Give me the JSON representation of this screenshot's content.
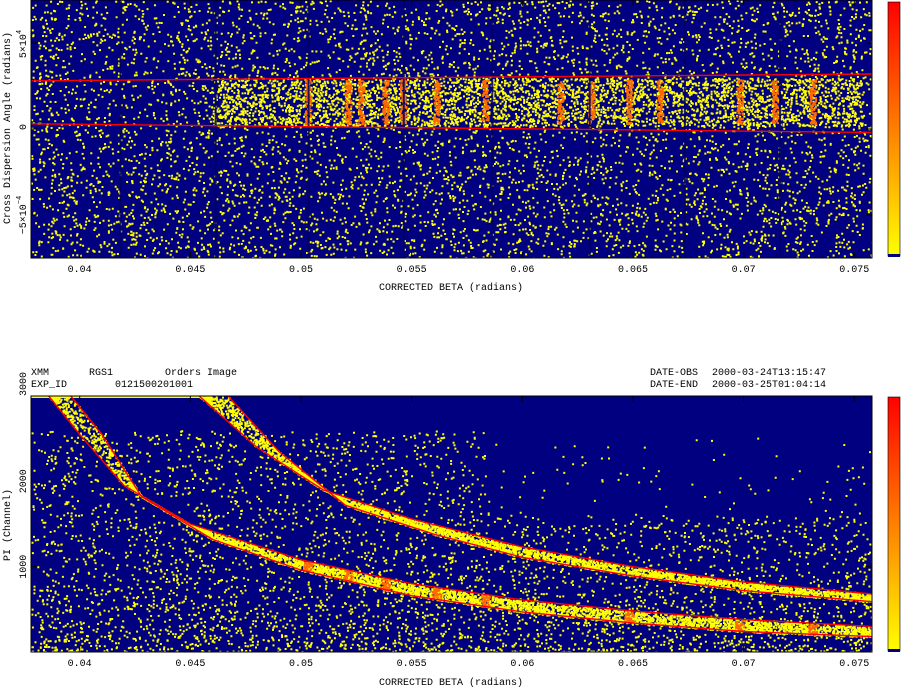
{
  "chart_data": [
    {
      "type": "heatmap",
      "title": "",
      "xlabel": "CORRECTED BETA (radians)",
      "ylabel": "Cross Dispersion Angle (radians)",
      "xlim": [
        0.0378,
        0.0758
      ],
      "ylim": [
        -0.00075,
        0.00075
      ],
      "x_ticks": [
        0.04,
        0.045,
        0.05,
        0.055,
        0.06,
        0.065,
        0.07,
        0.075
      ],
      "x_tick_labels": [
        "0.04",
        "0.045",
        "0.05",
        "0.055",
        "0.06",
        "0.065",
        "0.07",
        "0.075"
      ],
      "y_ticks": [
        -0.0005,
        0,
        0.0005
      ],
      "y_tick_labels": {
        "neg_mantissa": "−5×10",
        "exp": "−4",
        "zero": "0",
        "pos_mantissa": "5×10"
      },
      "colormap": [
        "#000080",
        "#ffff00",
        "#ff0000"
      ],
      "source_band": {
        "y_low": 2e-05,
        "y_high": 0.0003
      },
      "extraction_region": [
        [
          0.0378,
          3e-05
        ],
        [
          0.0378,
          0.00028
        ],
        [
          0.0758,
          0.00032
        ],
        [
          0.0758,
          -2e-05
        ]
      ],
      "emission_lines": [
        0.0503,
        0.0521,
        0.0527,
        0.0538,
        0.0546,
        0.0561,
        0.0583,
        0.0617,
        0.0631,
        0.0648,
        0.0662,
        0.0698,
        0.0714,
        0.0731
      ]
    },
    {
      "type": "heatmap",
      "title": "Orders Image",
      "xlabel": "CORRECTED BETA (radians)",
      "ylabel": "PI (Channel)",
      "xlim": [
        0.0378,
        0.0758
      ],
      "ylim": [
        0,
        3000
      ],
      "x_ticks": [
        0.04,
        0.045,
        0.05,
        0.055,
        0.06,
        0.065,
        0.07,
        0.075
      ],
      "x_tick_labels": [
        "0.04",
        "0.045",
        "0.05",
        "0.055",
        "0.06",
        "0.065",
        "0.07",
        "0.075"
      ],
      "y_ticks": [
        1000,
        2000,
        3000
      ],
      "y_tick_labels": [
        "1000",
        "2000",
        "3000"
      ],
      "colormap": [
        "#000080",
        "#ffff00",
        "#ff0000"
      ],
      "header": {
        "mission": "XMM",
        "instrument": "RGS1",
        "image_type": "Orders Image",
        "exp_id_label": "EXP_ID",
        "exp_id": "0121500201001",
        "date_obs_label": "DATE-OBS",
        "date_obs": "2000-03-24T13:15:47",
        "date_end_label": "DATE-END",
        "date_end": "2000-03-25T01:04:14"
      },
      "order_curves": [
        {
          "name": "",
          "inner": [
            [
              0.0386,
              3000
            ],
            [
              0.04,
              2550
            ],
            [
              0.042,
              1950
            ],
            [
              0.045,
              1500
            ],
            [
              0.05,
              1080
            ],
            [
              0.055,
              800
            ],
            [
              0.06,
              610
            ],
            [
              0.065,
              480
            ],
            [
              0.07,
              380
            ],
            [
              0.0758,
              300
            ]
          ],
          "outer": [
            [
              0.0396,
              3000
            ],
            [
              0.041,
              2550
            ],
            [
              0.0428,
              1820
            ],
            [
              0.046,
              1320
            ],
            [
              0.05,
              960
            ],
            [
              0.055,
              660
            ],
            [
              0.06,
              470
            ],
            [
              0.065,
              340
            ],
            [
              0.07,
              240
            ],
            [
              0.0758,
              180
            ]
          ]
        },
        {
          "name": "",
          "inner": [
            [
              0.0454,
              3000
            ],
            [
              0.048,
              2400
            ],
            [
              0.051,
              1900
            ],
            [
              0.055,
              1560
            ],
            [
              0.06,
              1230
            ],
            [
              0.065,
              1000
            ],
            [
              0.07,
              820
            ],
            [
              0.0758,
              680
            ]
          ],
          "outer": [
            [
              0.0467,
              3000
            ],
            [
              0.049,
              2350
            ],
            [
              0.052,
              1720
            ],
            [
              0.056,
              1380
            ],
            [
              0.06,
              1110
            ],
            [
              0.065,
              890
            ],
            [
              0.07,
              720
            ],
            [
              0.0758,
              590
            ]
          ]
        }
      ],
      "emission_lines": [
        0.0503,
        0.0521,
        0.0538,
        0.0561,
        0.0583,
        0.0648,
        0.0698,
        0.0731
      ]
    }
  ]
}
